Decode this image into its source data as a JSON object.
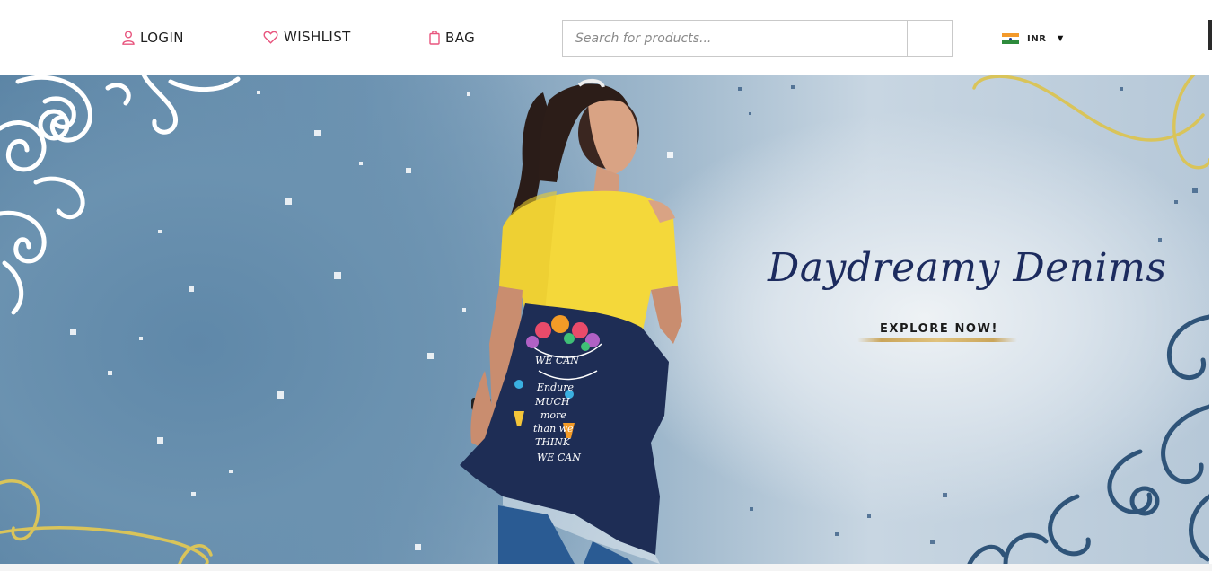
{
  "header": {
    "login_label": "LOGIN",
    "wishlist_label": "WISHLIST",
    "bag_label": "BAG",
    "search": {
      "placeholder": "Search for products...",
      "value": ""
    },
    "currency": {
      "code": "INR",
      "flag_icon": "india-flag-icon"
    }
  },
  "banner": {
    "title": "Daydreamy Denims",
    "cta_label": "EXPLORE NOW!",
    "jacket_text": [
      "WE CAN",
      "Endure",
      "MUCH",
      "more",
      "than we",
      "THINK",
      "WE CAN"
    ]
  },
  "colors": {
    "accent_pink": "#e8557e",
    "title_navy": "#1c2b5e",
    "banner_blue": "#6b92b0",
    "shirt_yellow": "#f4d83a",
    "denim": "#1e2d55"
  }
}
